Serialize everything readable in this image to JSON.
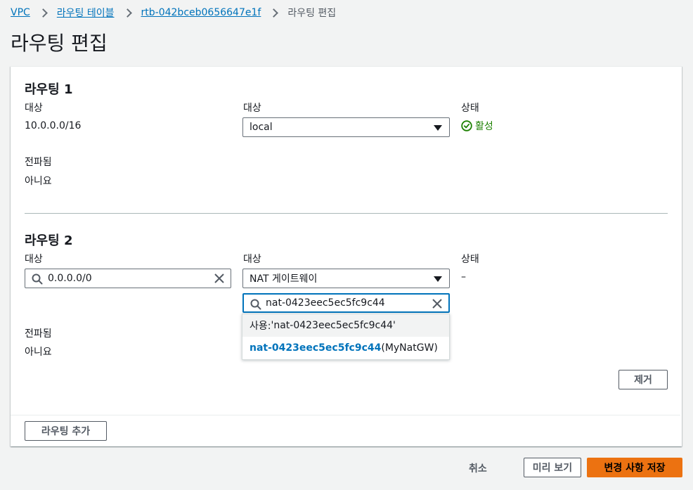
{
  "breadcrumb": {
    "items": [
      "VPC",
      "라우팅 테이블",
      "rtb-042bceb0656647e1f"
    ],
    "current": "라우팅 편집"
  },
  "page": {
    "title": "라우팅 편집"
  },
  "routes": [
    {
      "title": "라우팅 1",
      "destination_label": "대상",
      "destination_value": "10.0.0.0/16",
      "target_label": "대상",
      "target_value": "local",
      "status_label": "상태",
      "status_value": "활성",
      "propagated_label": "전파됨",
      "propagated_value": "아니요"
    },
    {
      "title": "라우팅 2",
      "destination_label": "대상",
      "destination_value": "0.0.0.0/0",
      "target_label": "대상",
      "target_value": "NAT 게이트웨이",
      "target_search_value": "nat-0423eec5ec5fc9c44",
      "status_label": "상태",
      "status_value": "–",
      "propagated_label": "전파됨",
      "propagated_value": "아니요",
      "dropdown_options": [
        {
          "prefix": "사용: ",
          "text": "'nat-0423eec5ec5fc9c44'"
        },
        {
          "id": "nat-0423eec5ec5fc9c44",
          "suffix": " (MyNatGW)"
        }
      ],
      "remove_label": "제거"
    }
  ],
  "add_route_label": "라우팅 추가",
  "actions": {
    "cancel": "취소",
    "preview": "미리 보기",
    "save": "변경 사항 저장"
  },
  "colors": {
    "link": "#0073bb",
    "success": "#1d8102",
    "primary": "#ec7211"
  }
}
